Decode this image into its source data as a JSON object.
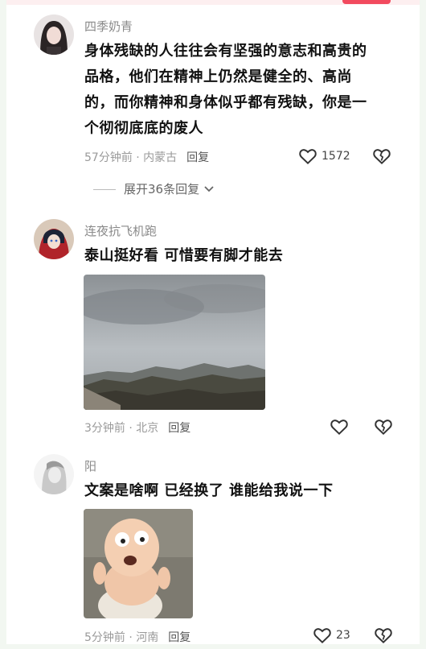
{
  "comments": [
    {
      "username": "四季奶青",
      "lines": [
        "身体残缺的人往往会有坚强的意志和高贵的",
        "品格，他们在精神上仍然是健全的、高尚",
        "的，而你精神和身体似乎都有残缺，你是一",
        "个彻彻底底的废人"
      ],
      "time_location": "57分钟前 · 内蒙古",
      "reply_label": "回复",
      "likes": "1572",
      "expand_label": "展开36条回复"
    },
    {
      "username": "连夜抗飞机跑",
      "text": "泰山挺好看 可惜要有脚才能去",
      "time_location": "3分钟前 · 北京",
      "reply_label": "回复"
    },
    {
      "username": "阳",
      "text": "文案是啥啊 已经换了 谁能给我说一下",
      "time_location": "5分钟前 · 河南",
      "reply_label": "回复",
      "likes": "23"
    }
  ],
  "icons": {
    "like": "heart-outline-icon",
    "dislike": "broken-heart-icon",
    "expand": "chevron-down-icon"
  },
  "colors": {
    "accent": "#f24a5e",
    "meta": "#9a9a9a",
    "username": "#8a8a8a"
  }
}
